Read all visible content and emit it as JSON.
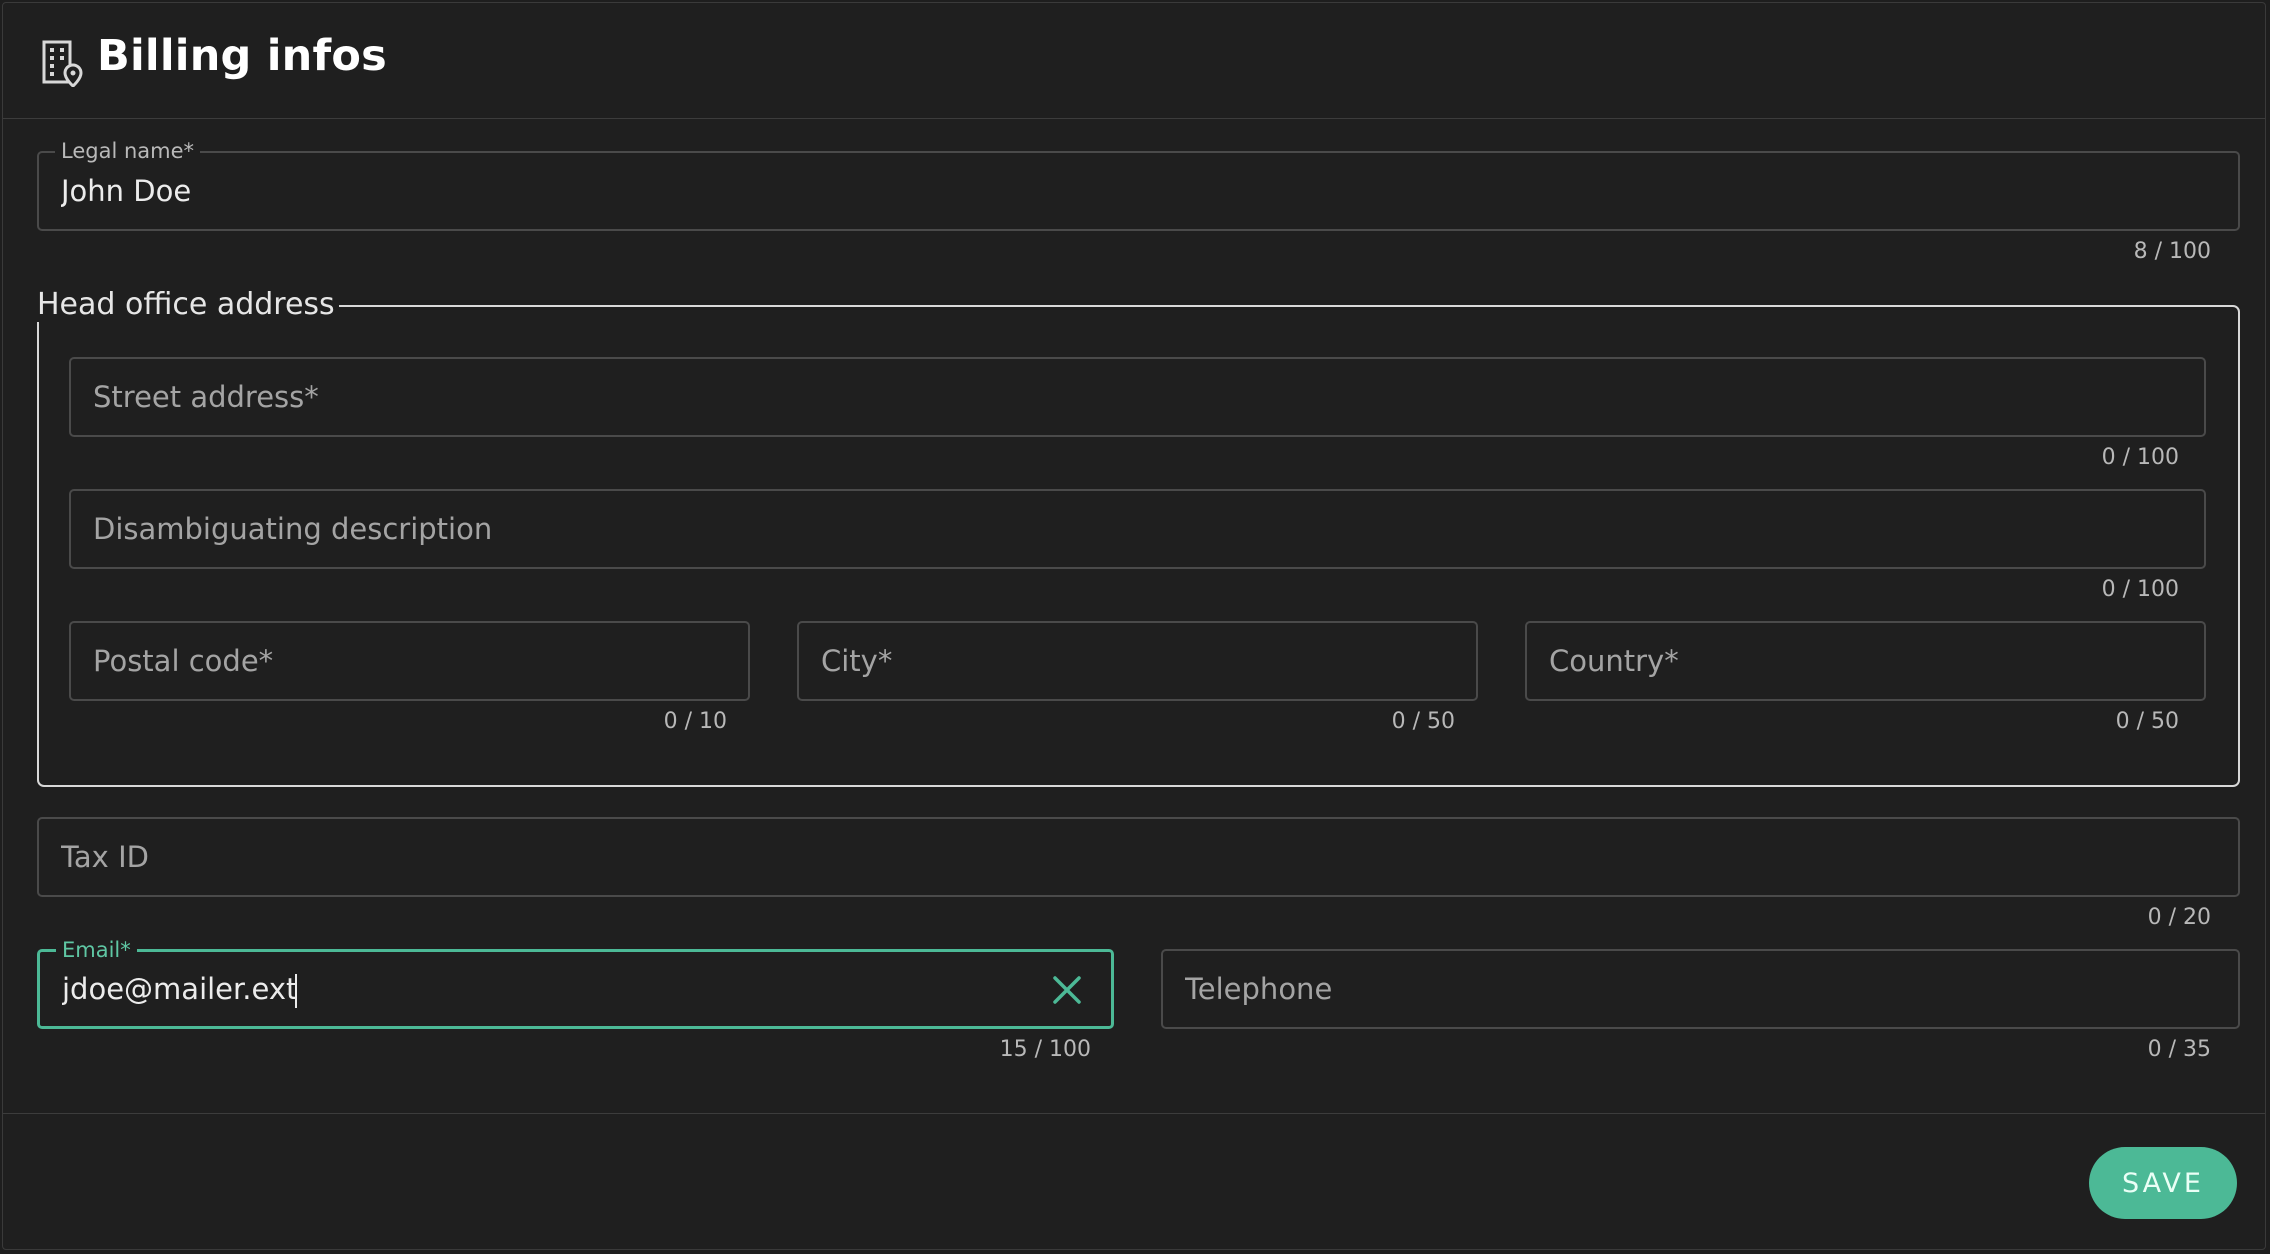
{
  "header": {
    "title": "Billing infos",
    "icon": "building-location-icon"
  },
  "legal_name": {
    "label": "Legal name*",
    "value": "John Doe",
    "counter": "8 / 100"
  },
  "address": {
    "legend": "Head office address",
    "street": {
      "placeholder": "Street address*",
      "counter": "0 / 100"
    },
    "disambiguation": {
      "placeholder": "Disambiguating description",
      "counter": "0 / 100"
    },
    "postal_code": {
      "placeholder": "Postal code*",
      "counter": "0 / 10"
    },
    "city": {
      "placeholder": "City*",
      "counter": "0 / 50"
    },
    "country": {
      "placeholder": "Country*",
      "counter": "0 / 50"
    }
  },
  "tax_id": {
    "placeholder": "Tax ID",
    "counter": "0 / 20"
  },
  "email": {
    "label": "Email*",
    "value": "jdoe@mailer.ext",
    "counter": "15 / 100",
    "clear_icon": "close-icon"
  },
  "telephone": {
    "placeholder": "Telephone",
    "counter": "0 / 35"
  },
  "footer": {
    "save_label": "SAVE"
  },
  "colors": {
    "accent": "#4cb996",
    "background": "#1f1f1f",
    "border": "#4a4a4a"
  }
}
